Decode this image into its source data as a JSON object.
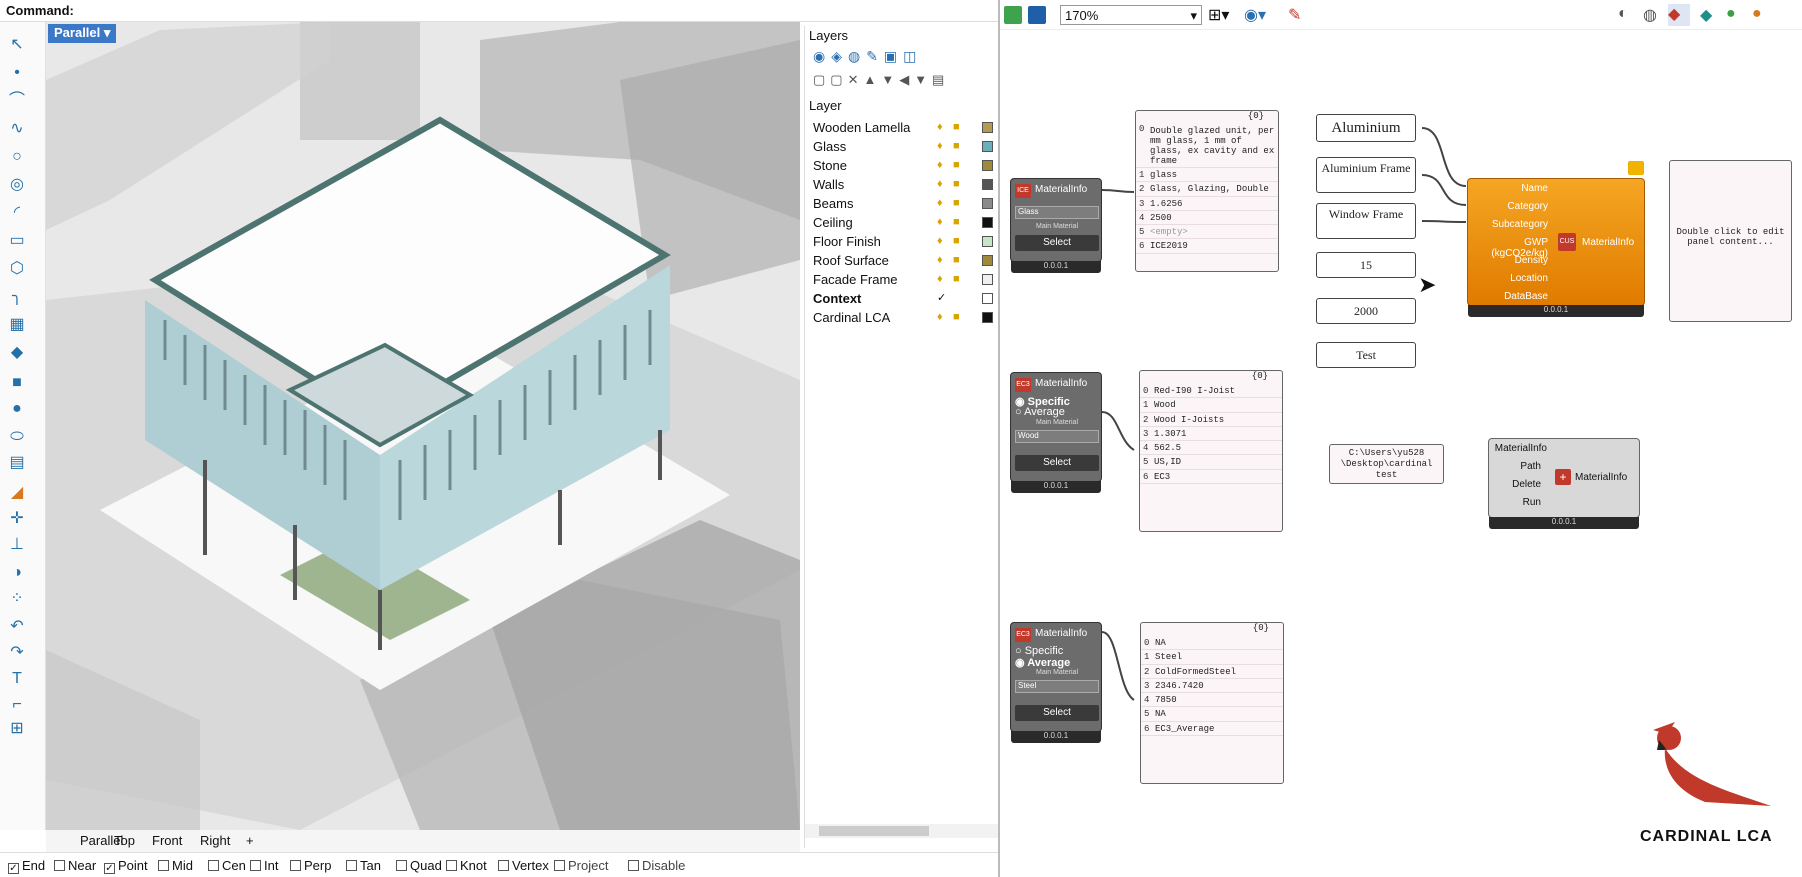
{
  "command": {
    "label": "Command:"
  },
  "viewport": {
    "label": "Parallel"
  },
  "layers": {
    "title": "Layers",
    "header": "Layer",
    "items": [
      {
        "name": "Wooden Lamella",
        "color": "#b59a54"
      },
      {
        "name": "Glass",
        "color": "#6ab0b8"
      },
      {
        "name": "Stone",
        "color": "#a08a3a"
      },
      {
        "name": "Walls",
        "color": "#555555"
      },
      {
        "name": "Beams",
        "color": "#8a8a8a"
      },
      {
        "name": "Ceiling",
        "color": "#111111"
      },
      {
        "name": "Floor Finish",
        "color": "#c9e5c9"
      },
      {
        "name": "Roof Surface",
        "color": "#a08a3a"
      },
      {
        "name": "Facade Frame",
        "color": "#f0f0f0"
      },
      {
        "name": "Context",
        "color": "#ffffff",
        "current": true
      },
      {
        "name": "Cardinal LCA",
        "color": "#111111"
      }
    ]
  },
  "view_tabs": [
    "Parallel",
    "Top",
    "Front",
    "Right"
  ],
  "osnaps": [
    {
      "label": "End",
      "checked": true
    },
    {
      "label": "Near",
      "checked": false
    },
    {
      "label": "Point",
      "checked": true
    },
    {
      "label": "Mid",
      "checked": false
    },
    {
      "label": "Cen",
      "checked": false
    },
    {
      "label": "Int",
      "checked": false
    },
    {
      "label": "Perp",
      "checked": false
    },
    {
      "label": "Tan",
      "checked": false
    },
    {
      "label": "Quad",
      "checked": false
    },
    {
      "label": "Knot",
      "checked": false
    },
    {
      "label": "Vertex",
      "checked": false
    },
    {
      "label": "Project",
      "checked": false
    },
    {
      "label": "Disable",
      "checked": false
    }
  ],
  "gh": {
    "zoom": "170%",
    "comp1": {
      "title": "MaterialInfo",
      "badge": "ICE",
      "dropdown": "Glass",
      "sub": "Main Material",
      "button": "Select",
      "version": "0.0.0.1"
    },
    "panel1": {
      "header": "{0}",
      "rows": [
        "Double glazed unit, per mm glass, 1 mm of glass, ex cavity and ex frame",
        "glass",
        "Glass, Glazing, Double",
        "1.6256",
        "2500",
        "<empty>",
        "ICE2019"
      ]
    },
    "comp2": {
      "title": "MaterialInfo",
      "badge": "EC3",
      "opt1": "Specific",
      "opt2": "Average",
      "sub": "Main Material",
      "dropdown": "Wood",
      "button": "Select",
      "version": "0.0.0.1"
    },
    "panel2": {
      "header": "{0}",
      "rows": [
        "Red-I90 I-Joist",
        "Wood",
        "Wood I-Joists",
        "1.3071",
        "562.5",
        "US,ID",
        "EC3"
      ]
    },
    "comp3": {
      "title": "MaterialInfo",
      "badge": "EC3",
      "opt1": "Specific",
      "opt2": "Average",
      "sub": "Main Material",
      "dropdown": "Steel",
      "button": "Select",
      "version": "0.0.0.1"
    },
    "panel3": {
      "header": "{0}",
      "rows": [
        "NA",
        "Steel",
        "ColdFormedSteel",
        "2346.7420",
        "7850",
        "NA",
        "EC3_Average"
      ]
    },
    "inputs": [
      "Aluminium",
      "Aluminium Frame",
      "Window Frame",
      "15",
      "2000",
      "Test"
    ],
    "cus": {
      "badge": "CUS",
      "inputs": [
        "Name",
        "Category",
        "Subcategory",
        "GWP (kgCO2e/kg)",
        "Density",
        "Location",
        "DataBase"
      ],
      "output": "MaterialInfo",
      "version": "0.0.0.1"
    },
    "edit_panel": "Double click to edit panel content...",
    "path": "C:\\Users\\yu528 \\Desktop\\cardinal test",
    "save": {
      "inputs": [
        "MaterialInfo",
        "Path",
        "Delete",
        "Run"
      ],
      "output": "MaterialInfo",
      "version": "0.0.0.1"
    },
    "logo": "CARDINAL LCA"
  }
}
